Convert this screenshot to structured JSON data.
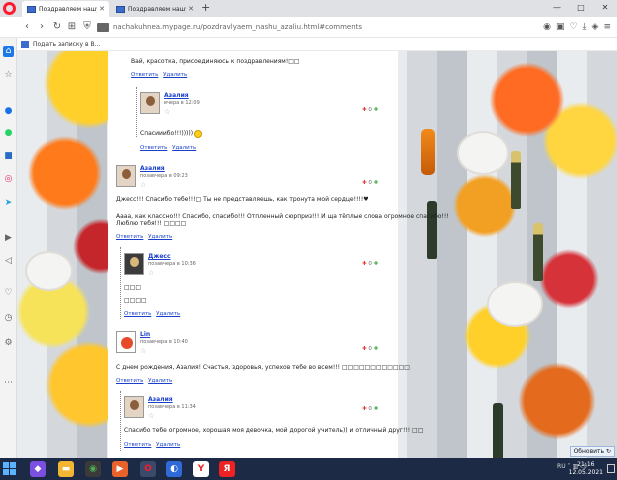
{
  "browser": {
    "tabs": [
      {
        "label": "Поздравляем нашу Азал...",
        "active": true
      },
      {
        "label": "Поздравляем нашу Азали...",
        "active": false
      }
    ],
    "new_tab": "+",
    "url": "nachakuhnea.mypage.ru/pozdravlyaem_nashu_azaliu.html#comments",
    "window_controls": [
      "—",
      "□",
      "✕"
    ],
    "bookmark": "Подать записку в В..."
  },
  "comments": [
    {
      "id": "c0",
      "text": "Вай, красотка, присоединяюсь к поздравлениям!□□",
      "reply_label": "Ответить",
      "delete_label": "Удалить"
    },
    {
      "id": "c1",
      "author": "Азалия",
      "time": "вчера в 12:09",
      "text": "Спасииибо!!!)))))",
      "reply_label": "Ответить",
      "delete_label": "Удалить",
      "votes": "0"
    },
    {
      "id": "c2",
      "author": "Азалия",
      "time": "позавчера в 09:23",
      "lines": [
        "Джесс!!! Спасибо тебе!!!□ Ты не представляешь, как тронута мой сердце!!!!♥",
        "Аааа, как классно!!! Спасибо, спасибо!!! Отпленный сюрприз!!! И ща тёплые слова огромное спасибо!!!",
        "Люблю тебя!!! □□□□"
      ],
      "reply_label": "Ответить",
      "delete_label": "Удалить",
      "votes": "0"
    },
    {
      "id": "c3",
      "author": "Джесс",
      "time": "позавчера в 10:36",
      "lines": [
        "□□□",
        "□□□□"
      ],
      "reply_label": "Ответить",
      "delete_label": "Удалить",
      "votes": "0"
    },
    {
      "id": "c4",
      "author": "Lin",
      "time": "позавчера в 10:40",
      "text": "С днем рождения, Азалия! Счастья, здоровья, успехов тебе во всем!!! □□□□□□□□□□□□",
      "reply_label": "Ответить",
      "delete_label": "Удалить",
      "votes": "0"
    },
    {
      "id": "c5",
      "author": "Азалия",
      "time": "позавчера в 11:34",
      "text": "Спасибо тебе огромное, хорошая моя девочка,  мой дорогой учитель)) и отличный друг!!! □□",
      "reply_label": "Ответить",
      "delete_label": "Удалить",
      "votes": "0"
    }
  ],
  "refresh_button": "Обновить",
  "taskbar": {
    "lang": "RU",
    "time": "21:16",
    "date": "12.05.2021"
  },
  "colors": {
    "link": "#1a40c9",
    "opera_red": "#ff1b2d",
    "taskbar": "#1d2a45"
  }
}
